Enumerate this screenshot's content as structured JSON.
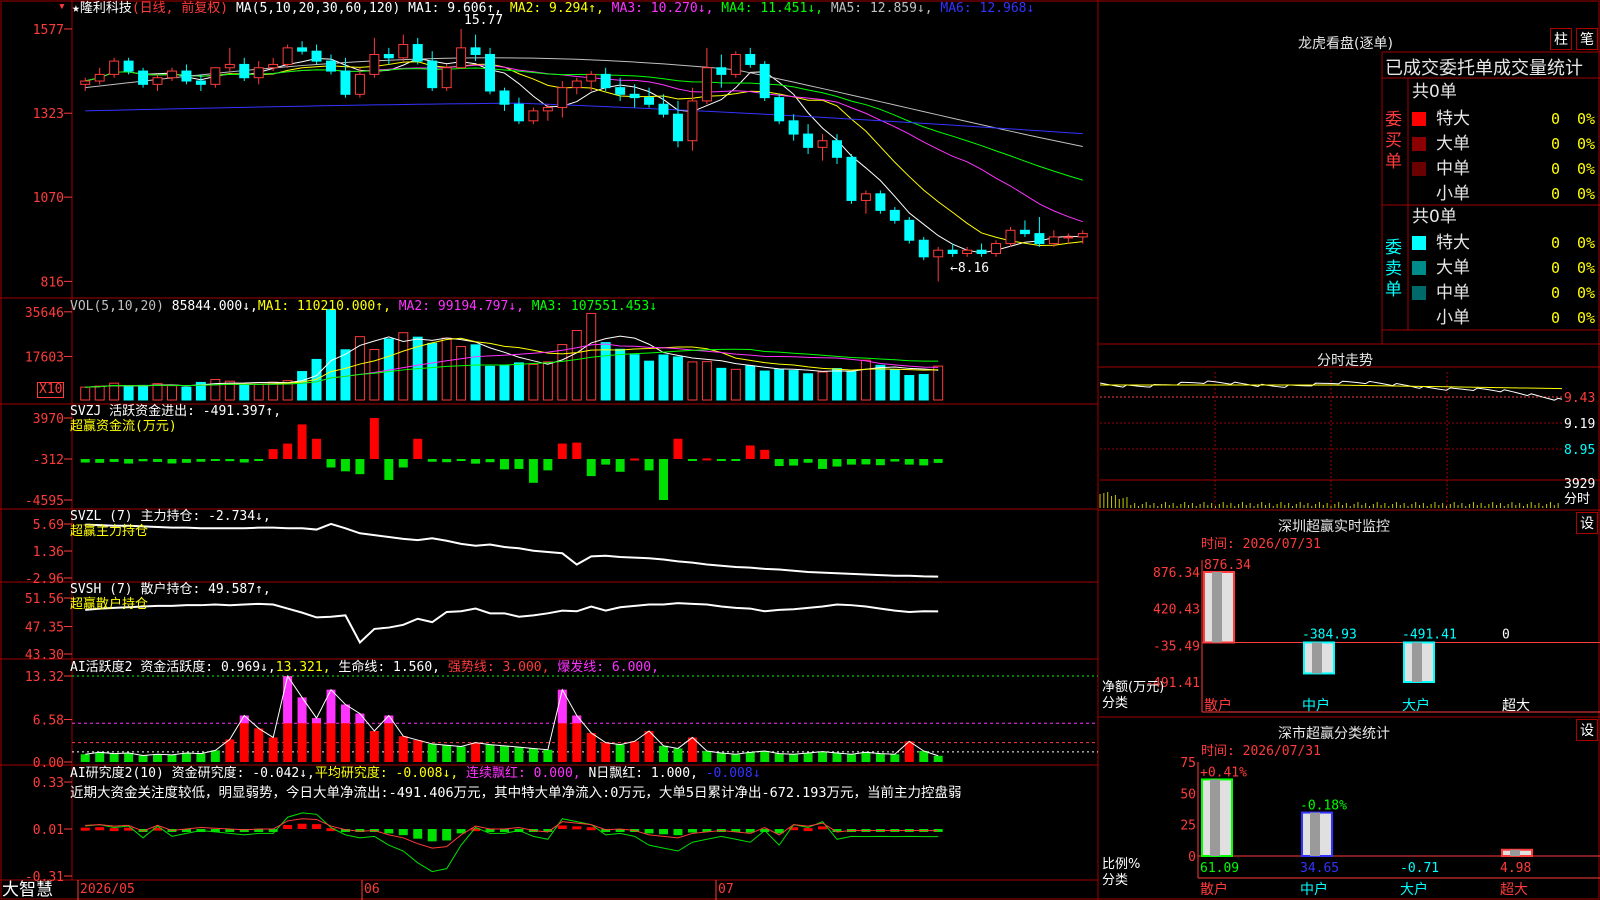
{
  "main": {
    "title": "★隆利科技",
    "mode": "(日线, 前复权)",
    "ma_label": "MA(5,10,20,30,60,120)",
    "ma": [
      {
        "t": "MA1: 9.606↑,",
        "c": "#ffffff"
      },
      {
        "t": "MA2: 9.294↑,",
        "c": "#ffff00"
      },
      {
        "t": "MA3: 10.270↓,",
        "c": "#ff33ff"
      },
      {
        "t": "MA4: 11.451↓,",
        "c": "#00ff00"
      },
      {
        "t": "MA5: 12.859↓,",
        "c": "#c0c0c0"
      },
      {
        "t": "MA6: 12.968↓",
        "c": "#3333ff"
      }
    ],
    "yticks": [
      "1577",
      "1323",
      "1070",
      "816"
    ],
    "high_label": "15.77",
    "low_label": "←8.16"
  },
  "vol": {
    "title": "VOL(5,10,20)",
    "value": "85844.000↓,",
    "ma1": "MA1: 110210.000↑,",
    "ma2": "MA2: 99194.797↓,",
    "ma3": "MA3: 107551.453↓",
    "yticks": [
      "35646",
      "17603"
    ],
    "unit": "X10"
  },
  "svzj": {
    "title": "SVZJ  活跃资金进出: -491.397↑,",
    "subtitle": "超赢资金流(万元)",
    "yticks": [
      "3970",
      "-312",
      "-4595"
    ]
  },
  "svzl": {
    "title": "SVZL (7) 主力持仓: -2.734↓,",
    "subtitle": "超赢主力持仓",
    "yticks": [
      "5.69",
      "1.36",
      "-2.96"
    ]
  },
  "svsh": {
    "title": "SVSH (7) 散户持仓: 49.587↑,",
    "subtitle": "超赢散户持仓",
    "yticks": [
      "51.56",
      "47.35",
      "43.30"
    ]
  },
  "ai1": {
    "title": "AI活跃度2 资金活跃度: 0.969↓,",
    "v2": "13.321,",
    "v3": "生命线: 1.560,",
    "v4": "强势线: 3.000,",
    "v5": "爆发线: 6.000,",
    "yticks": [
      "13.32",
      "6.58",
      "0.00"
    ]
  },
  "ai2": {
    "title": "AI研究度2(10) 资金研究度: -0.042↓,",
    "v2": "平均研究度: -0.008↓,",
    "v3": "连续飘红: 0.000,",
    "v4": "N日飘红: 1.000,",
    "v5": "-0.008↓",
    "note": "近期大资金关注度较低，明显弱势，今日大单净流出:-491.406万元，其中特大单净流入:0万元，大单5日累计净出-672.193万元，当前主力控盘弱",
    "yticks": [
      "0.33",
      "0.01",
      "-0.31"
    ]
  },
  "xaxis": {
    "brand": "大智慧",
    "labels": [
      "2026/05",
      "06",
      "07"
    ]
  },
  "lhb": {
    "title": "龙虎看盘(逐单)",
    "btn1": "柱",
    "btn2": "笔",
    "tabs": "已成交委托单成交量统计",
    "buy_label": "委买单",
    "sell_label": "委卖单",
    "buy_total": "共0单",
    "sell_total": "共0单",
    "buy_rows": [
      {
        "name": "特大",
        "v": "0",
        "p": "0%",
        "c": "#ff0000"
      },
      {
        "name": "大单",
        "v": "0",
        "p": "0%",
        "c": "#8b0000"
      },
      {
        "name": "中单",
        "v": "0",
        "p": "0%",
        "c": "#6a0000"
      },
      {
        "name": "小单",
        "v": "0",
        "p": "0%",
        "c": "#000000"
      }
    ],
    "sell_rows": [
      {
        "name": "特大",
        "v": "0",
        "p": "0%",
        "c": "#00ffff"
      },
      {
        "name": "大单",
        "v": "0",
        "p": "0%",
        "c": "#008b8b"
      },
      {
        "name": "中单",
        "v": "0",
        "p": "0%",
        "c": "#006a6a"
      },
      {
        "name": "小单",
        "v": "0",
        "p": "0%",
        "c": "#000000"
      }
    ]
  },
  "intraday": {
    "title": "分时走势",
    "yticks": [
      "9.43",
      "9.19",
      "8.95"
    ],
    "vol_tick": "3929",
    "vol_label": "分时"
  },
  "sz_monitor": {
    "title": "深圳超赢实时监控",
    "btn": "设",
    "time": "时间: 2026/07/31",
    "yticks": [
      "876.34",
      "420.43",
      "-35.49",
      "-491.41"
    ],
    "ylabel1": "净额(万元)",
    "ylabel2": "分类",
    "bars": [
      {
        "cat": "散户",
        "value": 876.34,
        "label": "876.34"
      },
      {
        "cat": "中户",
        "value": -384.93,
        "label": "-384.93"
      },
      {
        "cat": "大户",
        "value": -491.41,
        "label": "-491.41"
      },
      {
        "cat": "超大",
        "value": 0,
        "label": "0"
      }
    ]
  },
  "sz_class": {
    "title": "深市超赢分类统计",
    "btn": "设",
    "time": "时间: 2026/07/31",
    "yticks": [
      "75",
      "50",
      "25",
      "0"
    ],
    "ylabel1": "比例%",
    "ylabel2": "分类",
    "bars": [
      {
        "cat": "散户",
        "value": 61.09,
        "label": "61.09",
        "delta": "+0.41%",
        "cc": "#00ff00"
      },
      {
        "cat": "中户",
        "value": 34.65,
        "label": "34.65",
        "delta": "-0.18%",
        "cc": "#3333ff"
      },
      {
        "cat": "大户",
        "value": -0.71,
        "label": "-0.71",
        "delta": "",
        "cc": "#00ffff"
      },
      {
        "cat": "超大",
        "value": 4.98,
        "label": "4.98",
        "delta": "",
        "cc": "#ff3b3b"
      }
    ]
  },
  "chart_data": {
    "type": "candlestick",
    "candles": [
      [
        14.1,
        14.3,
        13.9,
        14.2
      ],
      [
        14.2,
        14.6,
        14.1,
        14.4
      ],
      [
        14.4,
        14.9,
        14.3,
        14.8
      ],
      [
        14.8,
        14.9,
        14.4,
        14.5
      ],
      [
        14.5,
        14.6,
        14.0,
        14.1
      ],
      [
        14.1,
        14.4,
        13.9,
        14.3
      ],
      [
        14.3,
        14.6,
        14.2,
        14.5
      ],
      [
        14.5,
        14.7,
        14.1,
        14.2
      ],
      [
        14.2,
        14.4,
        13.9,
        14.1
      ],
      [
        14.1,
        14.6,
        14.0,
        14.6
      ],
      [
        14.6,
        15.2,
        14.5,
        14.7
      ],
      [
        14.7,
        14.9,
        14.2,
        14.3
      ],
      [
        14.3,
        14.8,
        14.1,
        14.6
      ],
      [
        14.6,
        14.9,
        14.5,
        14.7
      ],
      [
        14.7,
        15.3,
        14.6,
        15.2
      ],
      [
        15.2,
        15.4,
        15.0,
        15.1
      ],
      [
        15.1,
        15.3,
        14.7,
        14.8
      ],
      [
        14.8,
        15.0,
        14.4,
        14.5
      ],
      [
        14.5,
        14.9,
        13.7,
        13.8
      ],
      [
        13.8,
        14.6,
        13.7,
        14.4
      ],
      [
        14.4,
        15.5,
        14.3,
        15.0
      ],
      [
        15.0,
        15.2,
        14.7,
        14.9
      ],
      [
        14.9,
        15.6,
        14.8,
        15.3
      ],
      [
        15.3,
        15.5,
        14.7,
        14.8
      ],
      [
        14.8,
        15.1,
        13.9,
        14.0
      ],
      [
        14.0,
        14.7,
        13.9,
        14.6
      ],
      [
        14.6,
        15.77,
        14.6,
        15.2
      ],
      [
        15.2,
        15.6,
        14.8,
        15.0
      ],
      [
        15.0,
        15.2,
        13.8,
        13.9
      ],
      [
        13.9,
        14.0,
        13.3,
        13.5
      ],
      [
        13.5,
        13.7,
        12.9,
        13.0
      ],
      [
        13.0,
        13.4,
        12.9,
        13.3
      ],
      [
        13.3,
        13.5,
        13.0,
        13.4
      ],
      [
        13.4,
        14.2,
        13.1,
        14.0
      ],
      [
        14.0,
        14.3,
        13.8,
        14.2
      ],
      [
        14.2,
        14.5,
        13.9,
        14.4
      ],
      [
        14.4,
        14.6,
        13.9,
        14.0
      ],
      [
        14.0,
        14.3,
        13.6,
        13.8
      ],
      [
        13.8,
        14.1,
        13.4,
        13.7
      ],
      [
        13.7,
        14.0,
        13.4,
        13.5
      ],
      [
        13.5,
        13.8,
        13.1,
        13.2
      ],
      [
        13.2,
        13.6,
        12.2,
        12.4
      ],
      [
        12.4,
        14.0,
        12.1,
        13.6
      ],
      [
        13.6,
        15.2,
        13.5,
        14.6
      ],
      [
        14.6,
        15.0,
        14.0,
        14.4
      ],
      [
        14.4,
        15.1,
        14.3,
        15.0
      ],
      [
        15.0,
        15.2,
        14.6,
        14.7
      ],
      [
        14.7,
        14.8,
        13.6,
        13.7
      ],
      [
        13.7,
        13.8,
        12.9,
        13.0
      ],
      [
        13.0,
        13.2,
        12.4,
        12.6
      ],
      [
        12.6,
        12.9,
        12.0,
        12.2
      ],
      [
        12.2,
        12.6,
        11.8,
        12.4
      ],
      [
        12.4,
        12.6,
        11.7,
        11.9
      ],
      [
        11.9,
        12.0,
        10.5,
        10.6
      ],
      [
        10.6,
        10.9,
        10.2,
        10.8
      ],
      [
        10.8,
        10.9,
        10.2,
        10.3
      ],
      [
        10.3,
        10.4,
        9.9,
        10.0
      ],
      [
        10.0,
        10.1,
        9.3,
        9.4
      ],
      [
        9.4,
        9.5,
        8.8,
        8.9
      ],
      [
        8.9,
        9.2,
        8.16,
        9.1
      ],
      [
        9.1,
        9.3,
        8.9,
        9.0
      ],
      [
        9.0,
        9.2,
        8.9,
        9.1
      ],
      [
        9.1,
        9.3,
        8.9,
        9.0
      ],
      [
        9.0,
        9.4,
        8.9,
        9.3
      ],
      [
        9.3,
        9.8,
        9.2,
        9.7
      ],
      [
        9.7,
        10.0,
        9.5,
        9.6
      ],
      [
        9.6,
        10.1,
        9.2,
        9.3
      ],
      [
        9.3,
        9.7,
        9.2,
        9.5
      ],
      [
        9.5,
        9.6,
        9.3,
        9.5
      ],
      [
        9.5,
        9.7,
        9.3,
        9.6
      ]
    ],
    "volume": [
      5200,
      5600,
      6800,
      5400,
      5900,
      6600,
      5800,
      5200,
      7100,
      8300,
      7600,
      6100,
      6300,
      7200,
      7800,
      11500,
      16400,
      36500,
      20300,
      25600,
      20400,
      24700,
      27200,
      25400,
      22900,
      25000,
      21600,
      22300,
      13600,
      13900,
      15000,
      14400,
      15400,
      22400,
      28100,
      35000,
      23200,
      20500,
      18300,
      15700,
      18200,
      17400,
      15400,
      15500,
      12800,
      12400,
      13800,
      11700,
      12300,
      11900,
      10600,
      11300,
      12700,
      11500,
      16100,
      14000,
      12300,
      9900,
      10300,
      13700
    ],
    "svzj": [
      -680,
      -710,
      -620,
      -790,
      -550,
      -620,
      -780,
      -710,
      -600,
      -500,
      -540,
      -680,
      -400,
      720,
      1300,
      3300,
      1800,
      -1200,
      -1600,
      -1900,
      3970,
      -2500,
      -1200,
      1800,
      -600,
      -650,
      -400,
      -800,
      -650,
      -1400,
      -1350,
      -2800,
      -1500,
      1300,
      1400,
      -2100,
      -900,
      -1650,
      -260,
      -1500,
      -4595,
      1800,
      -320,
      -250,
      -380,
      -370,
      1100,
      650,
      -1050,
      -1000,
      -700,
      -1350,
      -1100,
      -900,
      -880,
      -960,
      -580,
      -900,
      -980,
      -720
    ],
    "svzl": [
      5.6,
      5.5,
      5.4,
      5.4,
      5.3,
      5.2,
      5.1,
      5.1,
      5.0,
      5.0,
      5.0,
      5.0,
      5.1,
      5.1,
      5.0,
      5.0,
      4.8,
      5.7,
      5.0,
      4.2,
      3.9,
      3.6,
      3.3,
      3.1,
      3.4,
      3.0,
      2.5,
      2.2,
      2.4,
      2.0,
      1.8,
      1.4,
      1.2,
      1.0,
      -0.8,
      0.5,
      0.6,
      0.4,
      0.3,
      0.2,
      0.0,
      -0.3,
      -0.5,
      -0.8,
      -1.0,
      -1.2,
      -1.3,
      -1.5,
      -1.6,
      -1.8,
      -2.0,
      -2.1,
      -2.2,
      -2.3,
      -2.4,
      -2.5,
      -2.6,
      -2.6,
      -2.7,
      -2.734
    ],
    "svsh": [
      49.8,
      50.0,
      50.1,
      50.2,
      50.3,
      50.4,
      50.4,
      50.5,
      50.5,
      50.6,
      50.5,
      50.6,
      50.7,
      50.6,
      50.0,
      49.4,
      48.7,
      48.8,
      49.0,
      45.0,
      47.0,
      47.2,
      47.6,
      48.5,
      48.0,
      49.5,
      49.6,
      50.0,
      49.3,
      49.3,
      48.8,
      49.0,
      49.3,
      49.7,
      49.6,
      50.3,
      49.7,
      50.2,
      50.4,
      50.6,
      50.6,
      50.8,
      50.7,
      50.6,
      50.3,
      50.1,
      50.0,
      49.6,
      49.8,
      49.9,
      50.1,
      50.3,
      50.6,
      50.5,
      50.3,
      50.0,
      49.7,
      49.5,
      49.6,
      49.587
    ],
    "ai_active": [
      1.2,
      1.5,
      1.3,
      1.4,
      1.0,
      1.2,
      1.1,
      1.4,
      1.3,
      1.8,
      3.5,
      7.2,
      5.2,
      3.8,
      13.3,
      10.0,
      6.8,
      11.2,
      8.9,
      7.5,
      4.8,
      7.2,
      4.0,
      3.4,
      2.8,
      2.6,
      2.4,
      3.0,
      2.7,
      2.5,
      2.3,
      2.1,
      1.9,
      11.2,
      7.2,
      4.5,
      3.0,
      2.7,
      3.2,
      4.8,
      2.5,
      2.1,
      3.8,
      1.7,
      1.4,
      1.2,
      1.5,
      1.7,
      1.3,
      1.2,
      1.4,
      1.6,
      1.4,
      1.2,
      1.5,
      1.3,
      1.2,
      3.2,
      1.7,
      0.969
    ],
    "ai_research": [
      0.03,
      0.04,
      0.02,
      0.03,
      -0.05,
      0.03,
      -0.04,
      -0.02,
      0.0,
      -0.01,
      -0.02,
      -0.03,
      -0.02,
      -0.02,
      0.09,
      0.12,
      0.11,
      0.02,
      -0.03,
      -0.05,
      -0.04,
      -0.1,
      -0.14,
      -0.22,
      -0.28,
      -0.26,
      -0.1,
      0.02,
      -0.02,
      -0.02,
      0.0,
      -0.04,
      -0.06,
      0.08,
      0.06,
      0.04,
      -0.03,
      -0.02,
      -0.04,
      -0.1,
      -0.12,
      -0.14,
      -0.08,
      -0.06,
      -0.04,
      -0.06,
      -0.08,
      0.0,
      -0.1,
      0.04,
      0.02,
      0.06,
      -0.06,
      -0.04,
      -0.042,
      -0.04,
      -0.042,
      -0.04,
      -0.042,
      -0.042
    ]
  }
}
